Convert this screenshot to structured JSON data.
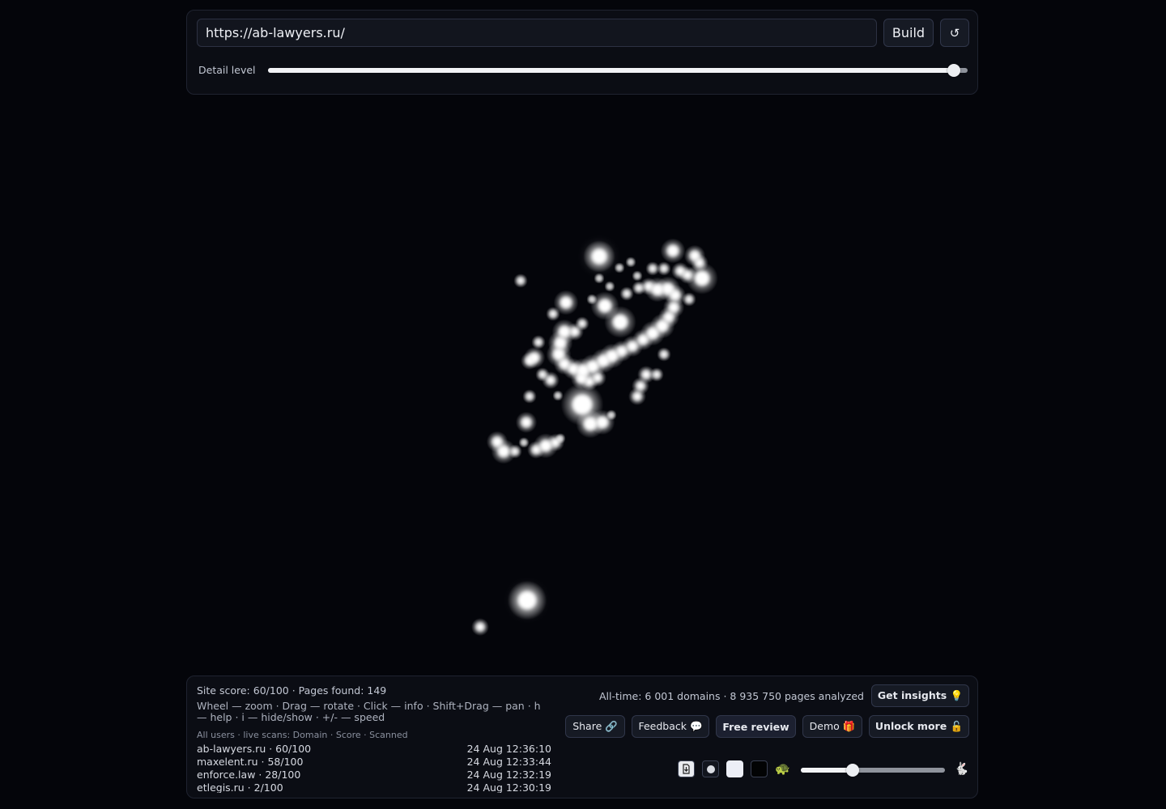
{
  "header": {
    "url_value": "https://ab-lawyers.ru/",
    "build_label": "Build",
    "refresh_glyph": "↺",
    "detail_label": "Detail level",
    "detail_level": 0.98
  },
  "stats": {
    "site_score": "Site score: 60/100 · Pages found: 149",
    "help": "Wheel — zoom · Drag — rotate · Click — info · Shift+Drag — pan · h — help · i — hide/show · +/- — speed",
    "all_time": "All-time: 6 001 domains · 8 935 750 pages analyzed"
  },
  "scans": {
    "header": "All users · live scans: Domain · Score · Scanned",
    "rows": [
      {
        "domain": "ab-lawyers.ru · 60/100",
        "time": "24 Aug 12:36:10"
      },
      {
        "domain": "maxelent.ru · 58/100",
        "time": "24 Aug 12:33:44"
      },
      {
        "domain": "enforce.law · 28/100",
        "time": "24 Aug 12:32:19"
      },
      {
        "domain": "etlegis.ru · 2/100",
        "time": "24 Aug 12:30:19"
      }
    ]
  },
  "actions": {
    "get_insights": "Get insights 💡",
    "share": "Share 🔗",
    "feedback": "Feedback 💬",
    "free_review": "Free review",
    "demo": "Demo 🎁",
    "unlock_more": "Unlock more 🔓"
  },
  "controls": {
    "export_icon": "download-icon",
    "dot_icon": "small-dot-icon",
    "light_theme_icon": "light-swatch-icon",
    "dark_theme_icon": "dark-swatch-icon",
    "slow_glyph": "🐢",
    "fast_glyph": "🐇",
    "speed_level": 0.36
  },
  "colors": {
    "background": "#04050a",
    "panel": "#0b0d14",
    "node": "#ffffff"
  }
}
